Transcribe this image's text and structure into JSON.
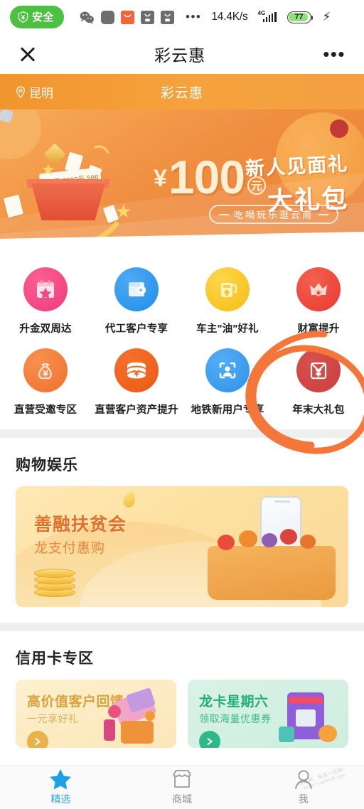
{
  "statusbar": {
    "safe_label": "安全",
    "safe_icon": "shield-yen-icon",
    "app_icons": [
      "wechat-icon",
      "app-grey-icon",
      "app-red-icon",
      "app-bag1-icon",
      "app-bag2-icon"
    ],
    "overflow_dots": "•••",
    "network_speed": "14.4K/s",
    "network_type": "4G",
    "signal_icon": "signal-bars-icon",
    "battery_level": "77",
    "charging_icon": "charging-bolt-icon",
    "accent_green": "#4cc040"
  },
  "navbar": {
    "close_icon": "close-icon",
    "title": "彩云惠",
    "more_icon": "more-dots-icon"
  },
  "subheader": {
    "location_icon": "location-pin-icon",
    "location": "昆明",
    "title": "彩云惠",
    "bg_color": "#f4a03c"
  },
  "hero": {
    "currency_symbol": "¥",
    "amount": "100",
    "amount_unit": "元",
    "headline_top": "新人见面礼",
    "headline_main": "大礼包",
    "subtitle": "吃喝玩乐逛云南",
    "gift_box_note": "100元 2000元 500元",
    "bg_color": "#ef8f41"
  },
  "grid": {
    "rows": [
      [
        {
          "label": "升金双周达",
          "icon": "calendar-star-icon",
          "disc_class": "d-pink",
          "color": "#ef3b7c"
        },
        {
          "label": "代工客户专享",
          "icon": "wallet-icon",
          "disc_class": "d-blue",
          "color": "#1f8fe8"
        },
        {
          "label": "车主\"油\"好礼",
          "icon": "fuel-can-icon",
          "disc_class": "d-yellow",
          "color": "#f3bd16"
        },
        {
          "label": "财富提升",
          "icon": "crown-gem-icon",
          "disc_class": "d-red",
          "color": "#e8392f"
        }
      ],
      [
        {
          "label": "直营受邀专区",
          "icon": "money-bag-icon",
          "disc_class": "d-orange",
          "color": "#ef6f2c"
        },
        {
          "label": "直营客户资产提升",
          "icon": "coin-stack-yen-icon",
          "disc_class": "d-orange2",
          "color": "#ea5a15"
        },
        {
          "label": "地铁新用户专享",
          "icon": "user-scan-icon",
          "disc_class": "d-blue2",
          "color": "#2f93e8"
        },
        {
          "label": "年末大礼包",
          "icon": "red-envelope-yen-icon",
          "disc_class": "d-red2",
          "color": "#c9403f"
        }
      ]
    ]
  },
  "shopping_section": {
    "title": "购物娱乐",
    "banner": {
      "title": "善融扶贫会",
      "subtitle": "龙支付惠购",
      "bg_color": "#fde0a0"
    }
  },
  "creditcard_section": {
    "title": "信用卡专区",
    "cards": [
      {
        "title": "高价值客户回馈",
        "subtitle": "一元享好礼",
        "card_class": "cc1",
        "bg_color": "#fbe7b8",
        "title_color": "#d9a23c",
        "icon": "arrow-circle-icon"
      },
      {
        "title": "龙卡星期六",
        "subtitle": "领取海量优惠券",
        "card_class": "cc2",
        "bg_color": "#cdeee0",
        "title_color": "#1fae7c",
        "icon": "arrow-circle-icon"
      }
    ]
  },
  "tabbar": {
    "items": [
      {
        "label": "精选",
        "icon": "star-icon",
        "active": true
      },
      {
        "label": "商城",
        "icon": "shop-icon",
        "active": false
      },
      {
        "label": "我",
        "icon": "person-icon",
        "active": false
      }
    ],
    "active_color": "#2ba3e8",
    "inactive_color": "#8d8d8d"
  },
  "watermark": {
    "line1": "赚客吧，有货一起赚！",
    "line2": "www.zuanke8.com"
  },
  "annotation": {
    "shape": "hand-drawn-circle",
    "color": "#f4763a",
    "target": "年末大礼包"
  }
}
